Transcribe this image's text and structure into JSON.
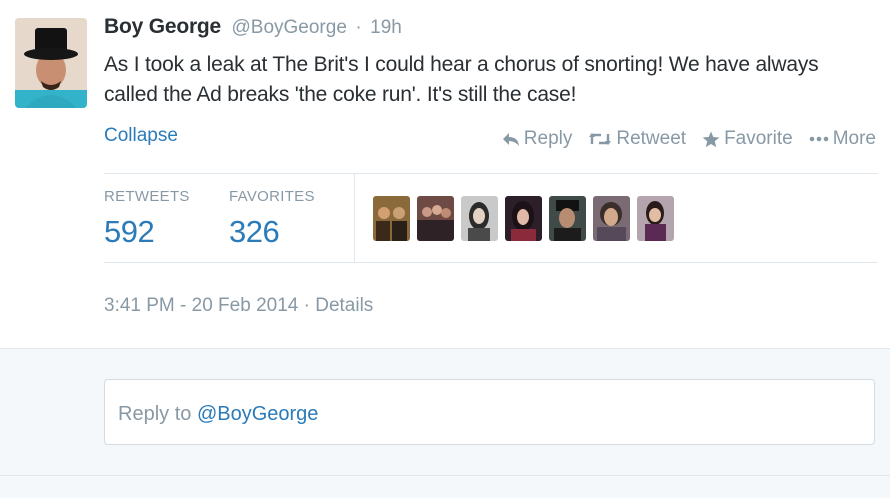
{
  "tweet": {
    "fullname": "Boy George",
    "username": "@BoyGeorge",
    "separator": "·",
    "time": "19h",
    "text": "As I took a leak at The Brit's I could hear a chorus of snorting! We have always called the Ad breaks 'the coke run'. It's still the case!",
    "collapse_label": "Collapse"
  },
  "actions": {
    "reply": "Reply",
    "retweet": "Retweet",
    "favorite": "Favorite",
    "more": "More"
  },
  "stats": {
    "retweets_label": "RETWEETS",
    "retweets_value": "592",
    "favorites_label": "FAVORITES",
    "favorites_value": "326"
  },
  "meta": {
    "timestamp": "3:41 PM - 20 Feb 2014",
    "separator": "·",
    "details": "Details"
  },
  "reply": {
    "prefix": "Reply to",
    "mention": "@BoyGeorge"
  },
  "colors": {
    "link": "#2b7bb9",
    "muted": "#8899a6",
    "text": "#292f33",
    "divider": "#e1e8ed",
    "reply_bg": "#f5f8fa"
  },
  "icons": [
    "reply-arrow-icon",
    "retweet-icon",
    "star-icon",
    "ellipsis-icon"
  ]
}
